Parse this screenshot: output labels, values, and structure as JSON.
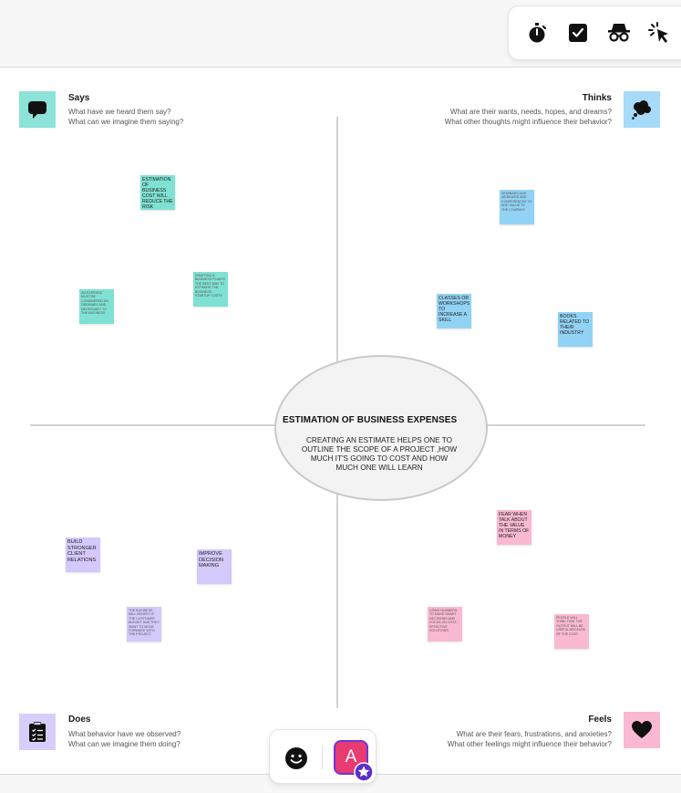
{
  "toolbar": {
    "icons": [
      "timer-icon",
      "checkbox-icon",
      "incognito-icon",
      "cursor-click-icon"
    ]
  },
  "center": {
    "title": "ESTIMATION OF BUSINESS EXPENSES",
    "description": "CREATING AN ESTIMATE HELPS ONE TO OUTLINE THE SCOPE OF A PROJECT ,HOW MUCH IT'S GOING TO COST AND HOW MUCH ONE WILL LEARN"
  },
  "quadrants": {
    "says": {
      "title": "Says",
      "line1": "What have we heard them say?",
      "line2": "What can we imagine them saying?",
      "icon": "speech-bubble-icon",
      "color": "#8ce3d8"
    },
    "thinks": {
      "title": "Thinks",
      "line1": "What are their wants, needs, hopes, and dreams?",
      "line2": "What other thoughts might influence their behavior?",
      "icon": "thought-bubble-icon",
      "color": "#a6daf8"
    },
    "does": {
      "title": "Does",
      "line1": "What behavior have we observed?",
      "line2": "What can we imagine them doing?",
      "icon": "clipboard-icon",
      "color": "#d9cdfb"
    },
    "feels": {
      "title": "Feels",
      "line1": "What are their fears, frustrations, and anxieties?",
      "line2": "What other feelings might influence their behavior?",
      "icon": "heart-icon",
      "color": "#fab8d2"
    }
  },
  "notes": {
    "says_1": "ESTIMATION OF BUSINESS COST WILL REDUCE THE RISK",
    "says_2": "DRAFTING A BUSINESS PLAN IS THE BEST WAY TO ESTIMATE THE BUSINESS STARTUP COSTS",
    "says_3": "AN EXPENSE MUST BE CONSIDERED AN ORDINARY AND NECESSARY TO THE BUSINESS",
    "thinks_1": "SEMINARS AND WEBINARS AND CONFERENCES TO ADD VALUE TO THE COMPANY",
    "thinks_2": "CLASSES OR WORKSHOPS TO INCREASE A SKILL",
    "thinks_3": "BOOKS RELATED TO THEIR INDUSTRY",
    "does_1": "BUILD STRONGER CLIENT RELATIONS",
    "does_2": "IMPROVE DECISION MAKING",
    "does_3": "THE BUSINESS WILL BENEFIT IF THE CUSTOMER BUDGET AND THEY WANT TO MOVE FORWARD WITH THE PROJECT",
    "feels_1": "FEAR WHEN TALK ABOUT THE VALUE IN TERMS OF MONEY",
    "feels_2": "USING NUMBERS TO MAKE SMART DECISIONS AND FOCUS ON COST-EFFECTIVE SOLUTIONS",
    "feels_3": "PEOPLE WILL THINK THAT THE OUTPUT WILL BE USEFUL BECAUSE OF THE COST"
  },
  "bottombar": {
    "emoji_icon": "smiley-icon",
    "avatar_letter": "A",
    "badge_icon": "star-badge-icon"
  },
  "colors": {
    "teal": "#7fe1d3",
    "blue": "#92d3f5",
    "purple": "#d5c8fb",
    "pink": "#f9b9d2",
    "avatar": "#e83b72"
  }
}
